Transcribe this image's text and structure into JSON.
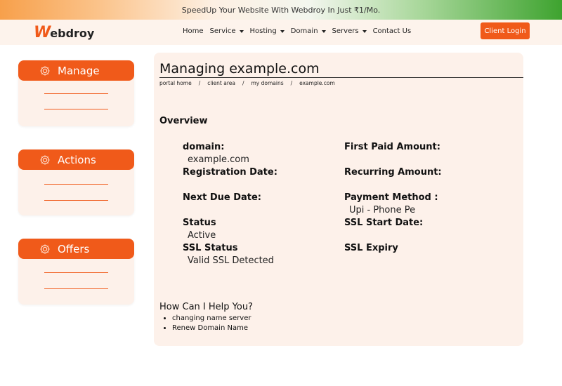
{
  "promo": {
    "text": "SpeedUp Your Website With Webdroy In Just ₹1/Mo."
  },
  "brand": {
    "logo_w": "W",
    "logo_rest": "ebdroy",
    "accent": "#f05a1a"
  },
  "nav": {
    "items": [
      {
        "label": "Home",
        "has_dropdown": false
      },
      {
        "label": "Service",
        "has_dropdown": true
      },
      {
        "label": "Hosting",
        "has_dropdown": true
      },
      {
        "label": "Domain",
        "has_dropdown": true
      },
      {
        "label": "Servers",
        "has_dropdown": true
      },
      {
        "label": "Contact Us",
        "has_dropdown": false
      }
    ],
    "login_label": "Client Login"
  },
  "sidebar": {
    "cards": [
      {
        "title": "Manage",
        "icon": "gear-icon"
      },
      {
        "title": "Actions",
        "icon": "gear-icon"
      },
      {
        "title": "Offers",
        "icon": "gear-icon"
      }
    ]
  },
  "main": {
    "title": "Managing example.com",
    "breadcrumb": [
      "portal home",
      "client area",
      "my domains",
      "example.com"
    ],
    "breadcrumb_sep": "/",
    "overview_heading": "Overview",
    "left_fields": [
      {
        "label": "domain:",
        "value": "example.com"
      },
      {
        "label": "Registration Date:",
        "value": ""
      },
      {
        "label": "Next Due Date:",
        "value": ""
      },
      {
        "label": "Status",
        "value": "Active"
      },
      {
        "label": "SSL Status",
        "value": "Valid SSL Detected"
      }
    ],
    "right_fields": [
      {
        "label": "First Paid Amount:",
        "value": ""
      },
      {
        "label": "Recurring Amount:",
        "value": ""
      },
      {
        "label": "Payment Method :",
        "value": "Upi - Phone Pe"
      },
      {
        "label": "SSL Start Date:",
        "value": ""
      },
      {
        "label": "SSL Expiry",
        "value": ""
      }
    ],
    "help_heading": "How Can I Help You?",
    "help_items": [
      "changing name server",
      "Renew Domain Name"
    ]
  }
}
